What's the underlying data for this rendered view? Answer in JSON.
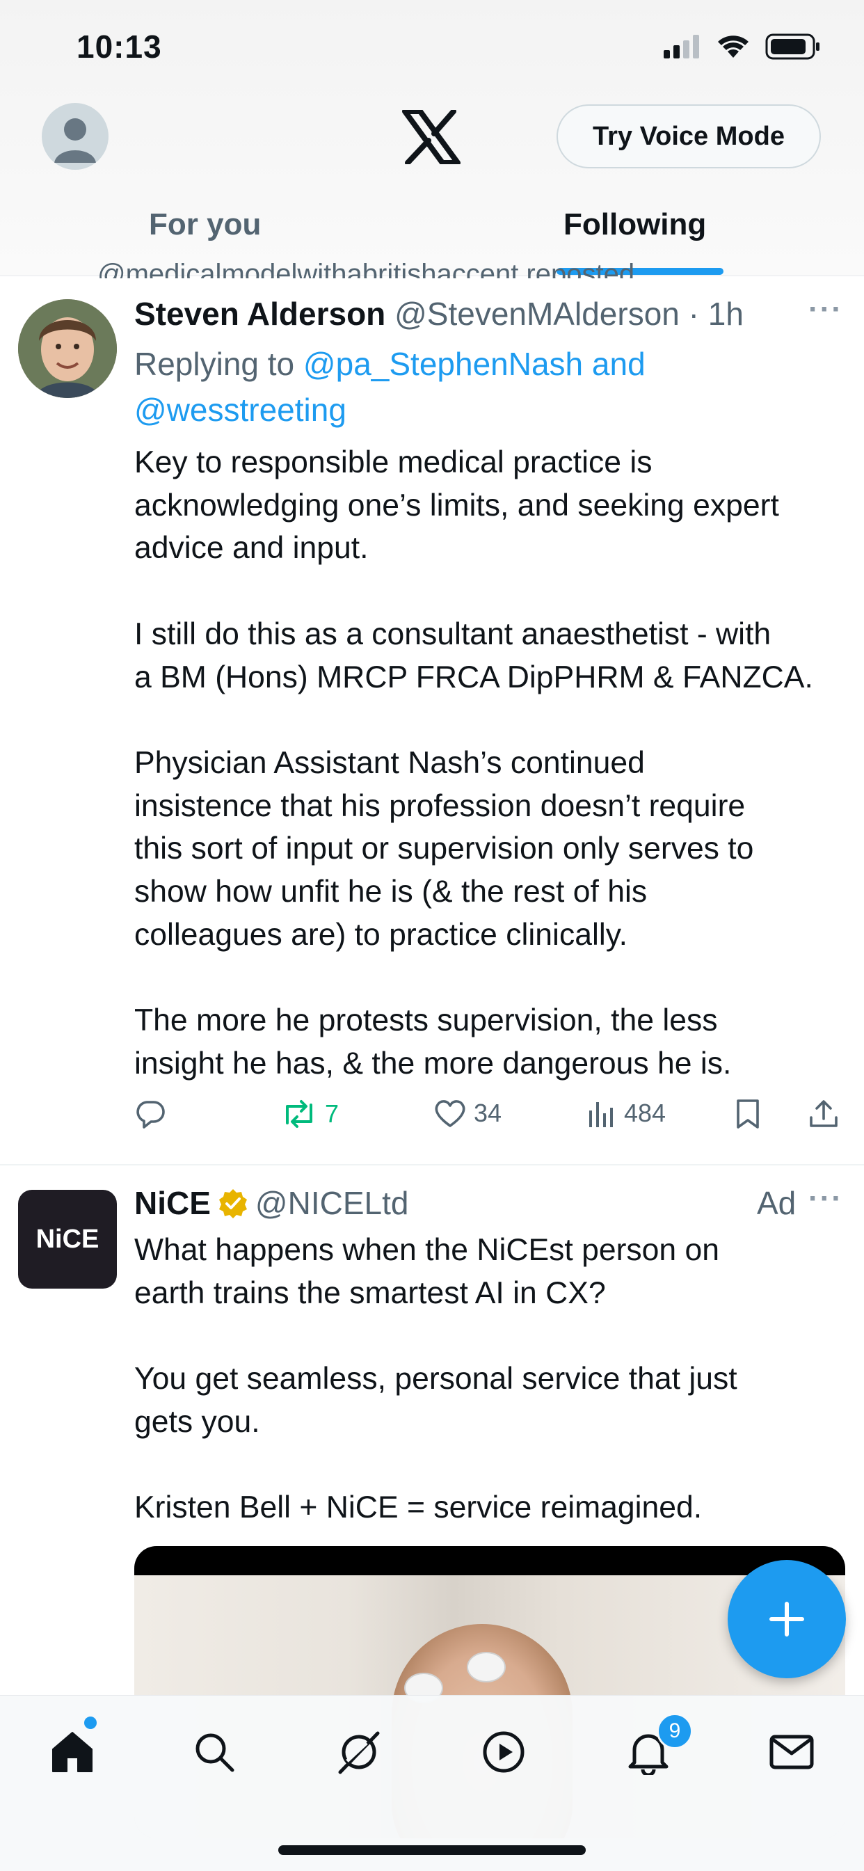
{
  "status_bar": {
    "time": "10:13"
  },
  "header": {
    "voice_button": "Try Voice Mode",
    "tabs": [
      {
        "label": "For you",
        "active": false
      },
      {
        "label": "Following",
        "active": true
      }
    ]
  },
  "tweets": [
    {
      "reposted_by": "@medicalmodelwithabritishaccent reposted",
      "name": "Steven Alderson",
      "handle": "@StevenMAlderson",
      "time": "· 1h",
      "replying_prefix": "Replying to ",
      "replying_to": "@pa_StephenNash and @wesstreeting",
      "text": "Key to responsible medical practice is\nacknowledging one’s limits, and seeking expert\nadvice and input.\n\nI still do this as a consultant anaesthetist - with\na BM (Hons) MRCP FRCA DipPHRM & FANZCA.\n\nPhysician Assistant Nash’s continued\ninsistence that his profession doesn’t require\nthis sort of input or supervision only serves to\nshow how unfit he is (& the rest of his\ncolleagues are) to practice clinically.\n\nThe more he protests supervision, the less\ninsight he has, & the more dangerous he is.",
      "stats": {
        "reposts": "7",
        "likes": "34",
        "views": "484"
      }
    },
    {
      "name": "NiCE",
      "handle": "@NICELtd",
      "ad_label": "Ad",
      "avatar_text": "NiCE",
      "text": "What happens when the NiCEst person on\nearth trains the smartest AI in CX?\n\nYou get seamless, personal service that just\ngets you.\n\nKristen Bell + NiCE = service reimagined."
    }
  ],
  "bottom_nav": {
    "items": [
      "home",
      "search",
      "grok",
      "video",
      "notifications",
      "messages"
    ],
    "notification_count": "9"
  },
  "colors": {
    "accent": "#1d9bf0",
    "repost": "#00ba7c",
    "text": "#0f1419",
    "secondary": "#536471"
  }
}
